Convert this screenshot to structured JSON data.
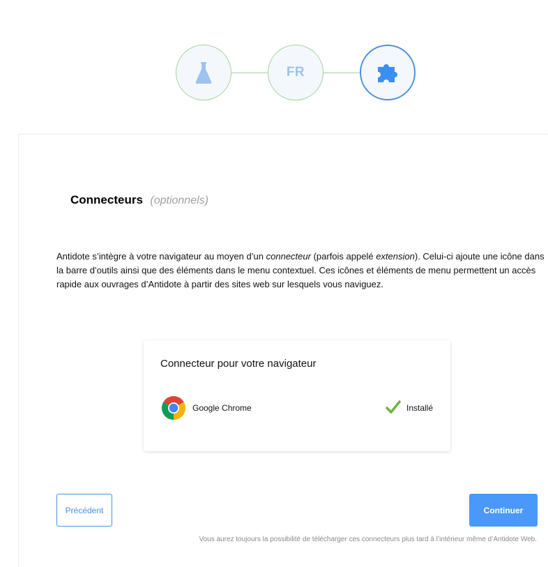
{
  "steps": [
    {
      "name": "flask",
      "state": "done",
      "icon": "flask-icon"
    },
    {
      "name": "language",
      "state": "done",
      "text": "FR"
    },
    {
      "name": "connectors",
      "state": "active",
      "icon": "puzzle-icon"
    }
  ],
  "colors": {
    "accent": "#4a90e2",
    "primary_button": "#4a98fa",
    "done_border": "#a6d39a",
    "check": "#6cb33e"
  },
  "section": {
    "title": "Connecteurs",
    "subtitle": "(optionnels)"
  },
  "description": {
    "part1": "Antidote s’intègre à votre navigateur au moyen d’un ",
    "term1": "connecteur",
    "part2": " (parfois appelé ",
    "term2": "extension",
    "part3": "). Celui-ci ajoute une icône dans la barre d’outils ainsi que des éléments dans le menu contextuel. Ces icônes et éléments de menu permettent un accès rapide aux ouvrages d’Antidote à partir des sites web sur lesquels vous naviguez."
  },
  "card": {
    "title": "Connecteur pour votre navigateur",
    "browser": {
      "name": "Google Chrome",
      "icon": "chrome-icon",
      "status": "Installé",
      "status_icon": "check-icon"
    }
  },
  "buttons": {
    "previous": "Précédent",
    "continue": "Continuer"
  },
  "footnote": "Vous aurez toujours la possibilité de télécharger ces connecteurs plus tard à l’intérieur même d’Antidote Web."
}
